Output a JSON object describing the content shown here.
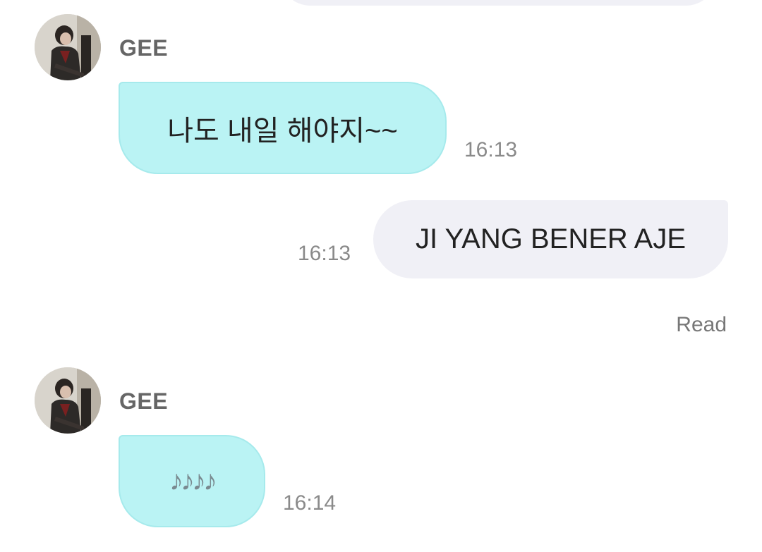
{
  "messages": [
    {
      "sender": "GEE",
      "direction": "incoming",
      "text": "나도 내일 해야지~~",
      "time": "16:13"
    },
    {
      "direction": "outgoing",
      "text": "JI YANG BENER AJE",
      "time": "16:13",
      "status": "Read"
    },
    {
      "sender": "GEE",
      "direction": "incoming",
      "text": "𝅘𝅥𝅮𝅘𝅥𝅮𝅘𝅥𝅮𝅘𝅥𝅮",
      "display": "♪♪♪♪",
      "time": "16:14"
    }
  ],
  "colors": {
    "incoming_bubble": "#baf3f4",
    "outgoing_bubble": "#f0f0f6",
    "name_text": "#666666",
    "time_text": "#8a8a8a"
  },
  "icons": {
    "avatar": "profile-photo-icon"
  }
}
